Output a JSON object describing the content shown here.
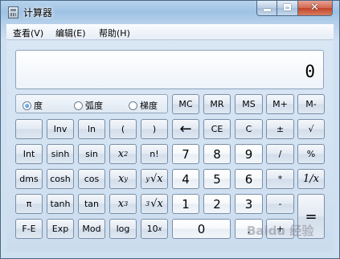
{
  "window": {
    "title": "计算器",
    "close_glyph": "✕"
  },
  "menu": [
    {
      "label": "查看(V)"
    },
    {
      "label": "编辑(E)"
    },
    {
      "label": "帮助(H)"
    }
  ],
  "display": {
    "value": "0"
  },
  "angle_modes": [
    {
      "label": "度",
      "selected": true
    },
    {
      "label": "弧度",
      "selected": false
    },
    {
      "label": "梯度",
      "selected": false
    }
  ],
  "buttons": {
    "memory": [
      "MC",
      "MR",
      "MS",
      "M+",
      "M-"
    ],
    "row2": [
      "",
      "Inv",
      "ln",
      "(",
      ")"
    ],
    "row2_right": [
      "←",
      "CE",
      "C",
      "±",
      "√"
    ],
    "row3": [
      "Int",
      "sinh",
      "sin",
      "x",
      "n!"
    ],
    "row3_sup": "2",
    "row3_right": [
      "7",
      "8",
      "9",
      "/",
      "%"
    ],
    "row4": [
      "dms",
      "cosh",
      "cos",
      "x",
      "x"
    ],
    "row4_sup": "y",
    "row4_root_idx": "y",
    "row4_right": [
      "4",
      "5",
      "6",
      "*",
      "1/x"
    ],
    "row5": [
      "π",
      "tanh",
      "tan",
      "x",
      "x"
    ],
    "row5_sup": "3",
    "row5_root_idx": "3",
    "row5_right": [
      "1",
      "2",
      "3",
      "-",
      "="
    ],
    "row6": [
      "F-E",
      "Exp",
      "Mod",
      "log",
      "10"
    ],
    "row6_sup": "x",
    "row6_right": [
      "0",
      ".",
      "+"
    ]
  },
  "watermark": "Baidu 经验"
}
